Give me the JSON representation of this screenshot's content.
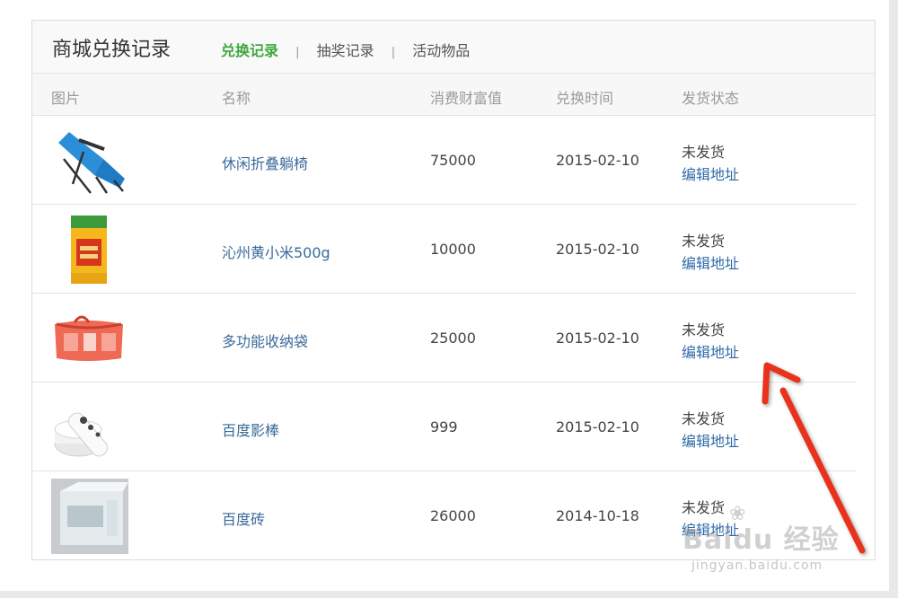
{
  "header": {
    "title": "商城兑换记录",
    "tabs": [
      {
        "label": "兑换记录",
        "active": true
      },
      {
        "label": "抽奖记录",
        "active": false
      },
      {
        "label": "活动物品",
        "active": false
      }
    ],
    "separator": "|"
  },
  "table": {
    "columns": [
      "图片",
      "名称",
      "消费财富值",
      "兑换时间",
      "发货状态"
    ],
    "rows": [
      {
        "image_icon": "folding-lounge-chair-image",
        "name": "休闲折叠躺椅",
        "cost": "75000",
        "date": "2015-02-10",
        "status": "未发货",
        "action": "编辑地址"
      },
      {
        "image_icon": "millet-bag-image",
        "name": "沁州黄小米500g",
        "cost": "10000",
        "date": "2015-02-10",
        "status": "未发货",
        "action": "编辑地址"
      },
      {
        "image_icon": "storage-bag-image",
        "name": "多功能收纳袋",
        "cost": "25000",
        "date": "2015-02-10",
        "status": "未发货",
        "action": "编辑地址"
      },
      {
        "image_icon": "baidu-tv-stick-image",
        "name": "百度影棒",
        "cost": "999",
        "date": "2015-02-10",
        "status": "未发货",
        "action": "编辑地址"
      },
      {
        "image_icon": "glass-brick-image",
        "name": "百度砖",
        "cost": "26000",
        "date": "2014-10-18",
        "status": "未发货",
        "action": "编辑地址"
      }
    ]
  },
  "watermark": {
    "brand": "Baidu 经验",
    "url": "jingyan.baidu.com"
  },
  "colors": {
    "active_tab": "#3ea83e",
    "link": "#2f6aa8",
    "arrow": "#e8321f"
  }
}
